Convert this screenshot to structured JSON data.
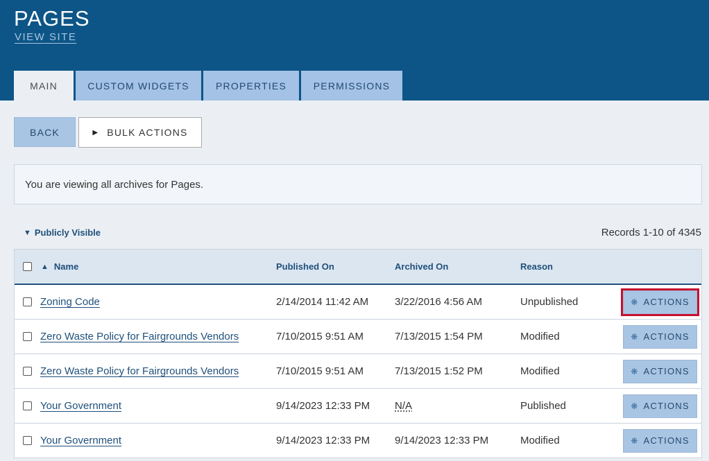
{
  "header": {
    "title": "PAGES",
    "view_site": "VIEW SITE"
  },
  "tabs": [
    {
      "label": "MAIN",
      "active": true
    },
    {
      "label": "CUSTOM WIDGETS",
      "active": false
    },
    {
      "label": "PROPERTIES",
      "active": false
    },
    {
      "label": "PERMISSIONS",
      "active": false
    }
  ],
  "toolbar": {
    "back_label": "BACK",
    "bulk_actions_label": "BULK ACTIONS"
  },
  "notice": "You are viewing all archives for Pages.",
  "filter": {
    "label": "Publicly Visible"
  },
  "records_text": "Records 1-10 of 4345",
  "table": {
    "columns": [
      "Name",
      "Published On",
      "Archived On",
      "Reason"
    ],
    "action_label": "ACTIONS",
    "rows": [
      {
        "name": "Zoning Code",
        "published": "2/14/2014 11:42 AM",
        "archived": "3/22/2016 4:56 AM",
        "reason": "Unpublished"
      },
      {
        "name": "Zero Waste Policy for Fairgrounds Vendors",
        "published": "7/10/2015 9:51 AM",
        "archived": "7/13/2015 1:54 PM",
        "reason": "Modified"
      },
      {
        "name": "Zero Waste Policy for Fairgrounds Vendors",
        "published": "7/10/2015 9:51 AM",
        "archived": "7/13/2015 1:52 PM",
        "reason": "Modified"
      },
      {
        "name": "Your Government",
        "published": "9/14/2023 12:33 PM",
        "archived": "N/A",
        "reason": "Published"
      },
      {
        "name": "Your Government",
        "published": "9/14/2023 12:33 PM",
        "archived": "9/14/2023 12:33 PM",
        "reason": "Modified"
      }
    ]
  },
  "colors": {
    "header_bg": "#0d5587",
    "tab_bg": "#a3c2e6",
    "button_bg": "#a9c5e4",
    "link": "#1f4f7a",
    "highlight": "#c8102e"
  }
}
